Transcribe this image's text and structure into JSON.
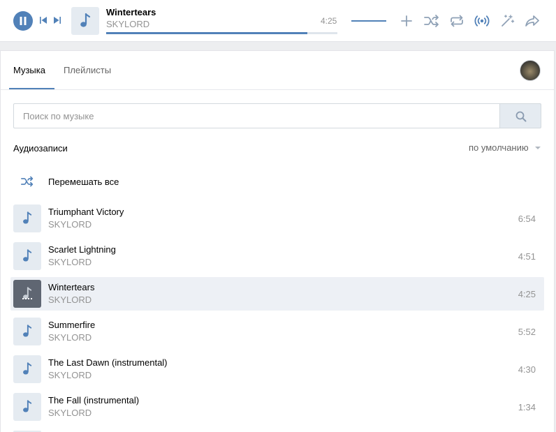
{
  "player": {
    "title": "Wintertears",
    "artist": "SKYLORD",
    "time": "4:25",
    "progress": 0.87,
    "volume": 1.0,
    "icons": [
      "pause-icon",
      "previous-icon",
      "next-icon",
      "add-icon",
      "shuffle-icon",
      "repeat-icon",
      "broadcast-icon",
      "recommendations-icon",
      "share-icon"
    ]
  },
  "tabs": [
    {
      "label": "Музыка",
      "active": true
    },
    {
      "label": "Плейлисты",
      "active": false
    }
  ],
  "search": {
    "placeholder": "Поиск по музыке",
    "value": ""
  },
  "section": {
    "title": "Аудиозаписи",
    "sort_label": "по умолчанию"
  },
  "shuffle_all_label": "Перемешать все",
  "tracks": [
    {
      "title": "Triumphant Victory",
      "artist": "SKYLORD",
      "duration": "6:54",
      "current": false
    },
    {
      "title": "Scarlet Lightning",
      "artist": "SKYLORD",
      "duration": "4:51",
      "current": false
    },
    {
      "title": "Wintertears",
      "artist": "SKYLORD",
      "duration": "4:25",
      "current": true
    },
    {
      "title": "Summerfire",
      "artist": "SKYLORD",
      "duration": "5:52",
      "current": false
    },
    {
      "title": "The Last Dawn (instrumental)",
      "artist": "SKYLORD",
      "duration": "4:30",
      "current": false
    },
    {
      "title": "The Fall (instrumental)",
      "artist": "SKYLORD",
      "duration": "1:34",
      "current": false
    }
  ],
  "colors": {
    "accent": "#5181b8",
    "muted": "#939393",
    "cover_bg": "#e5ebf1",
    "current_row": "#edf0f5"
  }
}
